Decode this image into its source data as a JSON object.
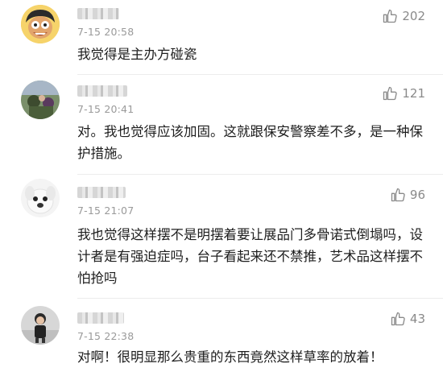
{
  "comments": [
    {
      "time": "7-15 20:58",
      "likes": "202",
      "text": "我觉得是主办方碰瓷"
    },
    {
      "time": "7-15 20:41",
      "likes": "121",
      "text": "对。我也觉得应该加固。这就跟保安警察差不多，是一种保护措施。"
    },
    {
      "time": "7-15 21:07",
      "likes": "96",
      "text": "我也觉得这样摆不是明摆着要让展品门多骨诺式倒塌吗，设计者是有强迫症吗，台子看起来还不禁推，艺术品这样摆不怕抢吗"
    },
    {
      "time": "7-15 22:38",
      "likes": "43",
      "text": "对啊！很明显那么贵重的东西竟然这样草率的放着！"
    }
  ],
  "icons": {
    "like": "thumbs-up-icon"
  }
}
